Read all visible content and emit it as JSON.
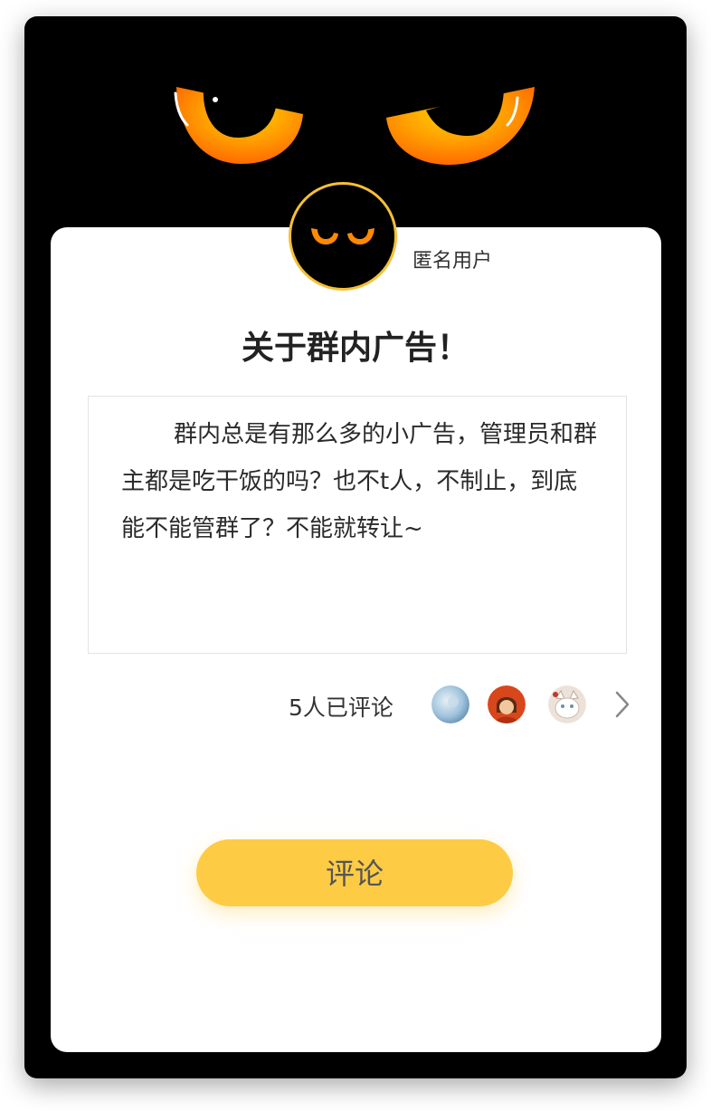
{
  "post": {
    "author": "匿名用户",
    "title": "关于群内广告！",
    "body": "群内总是有那么多的小广告，管理员和群主都是吃干饭的吗？也不t人，不制止，到底能不能管群了？不能就转让~"
  },
  "comments": {
    "count_label": "5人已评论",
    "avatars": [
      {
        "name": "commenter-avatar-1",
        "color": "#9fc3dc"
      },
      {
        "name": "commenter-avatar-2",
        "color": "#d8461c"
      },
      {
        "name": "commenter-avatar-3",
        "color": "#d8c4b6"
      }
    ]
  },
  "actions": {
    "comment_label": "评论"
  },
  "colors": {
    "accent": "#fecb45",
    "avatar_ring": "#f5c035",
    "eye_orange": "#ff7a00",
    "background": "#000000"
  },
  "icons": {
    "chevron": "chevron-right-icon"
  }
}
